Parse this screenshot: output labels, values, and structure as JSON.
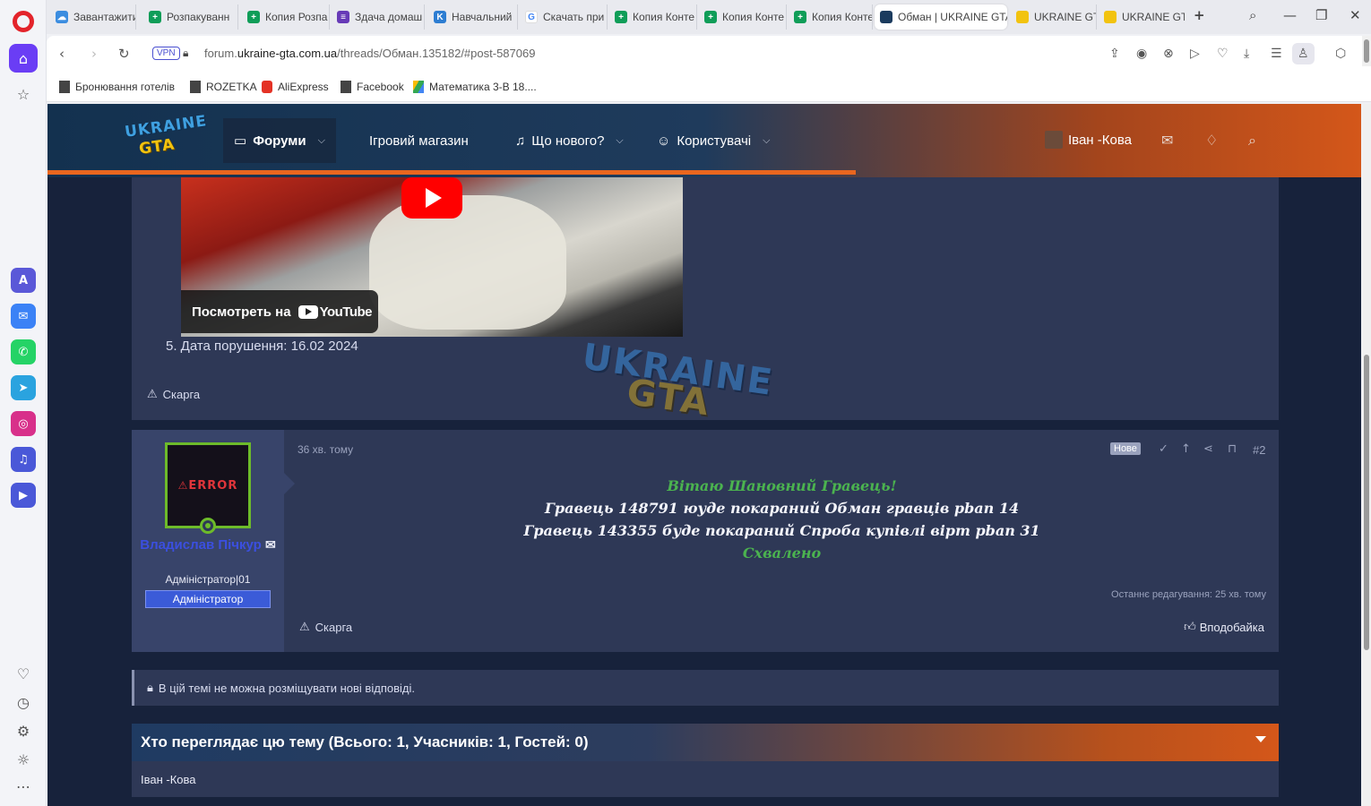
{
  "browser": {
    "tabs": [
      {
        "label": "Завантажити",
        "color": "#3b8de0"
      },
      {
        "label": "Розпакуванн",
        "color": "#0f9d58"
      },
      {
        "label": "Копия Розпа",
        "color": "#0f9d58"
      },
      {
        "label": "Здача домаш",
        "color": "#673ab7"
      },
      {
        "label": "Навчальний",
        "color": "#2d7dd2"
      },
      {
        "label": "Скачать при",
        "color": "#4285f4"
      },
      {
        "label": "Копия Конте",
        "color": "#0f9d58"
      },
      {
        "label": "Копия Конте",
        "color": "#0f9d58"
      },
      {
        "label": "Копия Конте",
        "color": "#0f9d58"
      },
      {
        "label": "Обман | UKRAINE GTA",
        "color": "#1b3b5e"
      },
      {
        "label": "UKRAINE GTA",
        "color": "#f2c30f"
      },
      {
        "label": "UKRAINE GTA",
        "color": "#f2c30f"
      }
    ],
    "vpn": "VPN",
    "url_prefix": "forum.",
    "url_domain": "ukraine-gta.com.ua",
    "url_path": "/threads/Обман.135182/#post-587069",
    "bookmarks": [
      "Бронювання готелів",
      "ROZETKA",
      "AliExpress",
      "Facebook",
      "Математика 3-В 18...."
    ]
  },
  "site": {
    "logo_top": "UKRAINE",
    "logo_bottom": "GTA",
    "nav": {
      "forums": "Форуми",
      "shop": "Ігровий магазин",
      "whats_new": "Що нового?",
      "users": "Користувачі"
    },
    "current_user": "Іван -Кова",
    "watermark_top": "UKRAINE",
    "watermark_bottom": "GTA"
  },
  "post1": {
    "video_watch": "Посмотреть на",
    "youtube": "YouTube",
    "violation_date": "5. Дата порушення: 16.02 2024",
    "report": "Скарга"
  },
  "post2": {
    "avatar_text": "ERROR",
    "author": "Владислав Пічкур",
    "user_title": "Адміністратор|01",
    "badge": "Адміністратор",
    "time": "36 хв. тому",
    "new_badge": "Нове",
    "post_number": "#2",
    "message": {
      "greeting": "Вітаю Шановний Гравець!",
      "line1": "Гравець 148791 юуде покараний Обман гравців pban 14",
      "line2": "Гравець 143355 буде покараний Спроба купівлі вірт pban 31",
      "status": "Схвалено"
    },
    "edited": "Останнє редагування: 25 хв. тому",
    "report": "Скарга",
    "like": "Вподобайка"
  },
  "notice": "В цій темі не можна розміщувати нові відповіді.",
  "who_viewing": {
    "title": "Хто переглядає цю тему (Всього: 1, Учасників: 1, Гостей: 0)",
    "users": "Іван -Кова"
  }
}
